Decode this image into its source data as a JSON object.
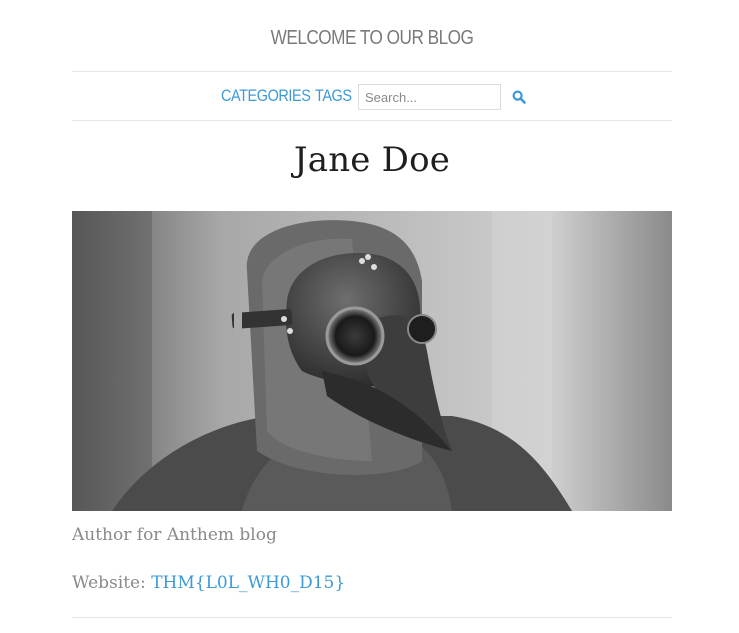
{
  "header": {
    "site_title": "WELCOME TO OUR BLOG"
  },
  "nav": {
    "categories_label": "CATEGORIES",
    "tags_label": "TAGS",
    "search_placeholder": "Search...",
    "search_value": "",
    "search_icon": "search-icon"
  },
  "author": {
    "name": "Jane Doe",
    "photo_alt": "Black and white photo of a person wearing a plague doctor mask",
    "bio": "Author for Anthem blog",
    "website_label": "Website:",
    "website_value": "THM{L0L_WH0_D15}"
  },
  "colors": {
    "accent": "#3c9ad6",
    "muted_text": "#8a8a8a",
    "title_text": "#1f1f1f",
    "divider": "#e6e6e6"
  }
}
